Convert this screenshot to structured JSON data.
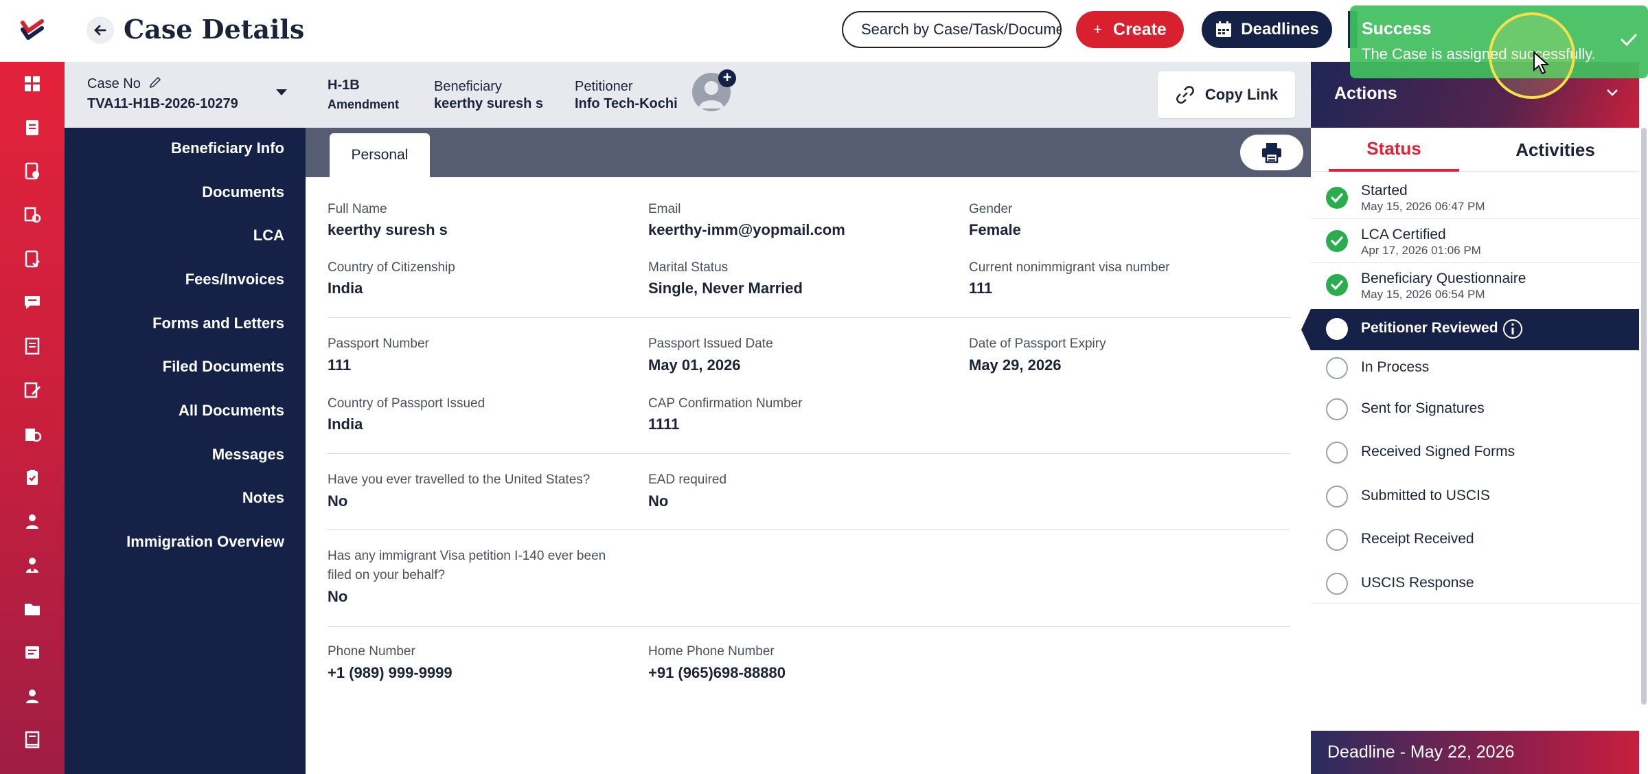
{
  "header": {
    "title": "Case Details",
    "search_placeholder": "Search by Case/Task/Document",
    "create_label": "Create",
    "deadlines_label": "Deadlines"
  },
  "case": {
    "case_no_label": "Case No",
    "case_no": "TVA11-H1B-2026-10279",
    "visa_type": "H-1B",
    "visa_subtype": "Amendment",
    "beneficiary_label": "Beneficiary",
    "beneficiary_name": "keerthy suresh s",
    "petitioner_label": "Petitioner",
    "petitioner_name": "Info Tech-Kochi",
    "copy_link_label": "Copy Link"
  },
  "sidenav": {
    "items": [
      {
        "label": "Beneficiary Info"
      },
      {
        "label": "Documents"
      },
      {
        "label": "LCA"
      },
      {
        "label": "Fees/Invoices"
      },
      {
        "label": "Forms and Letters"
      },
      {
        "label": "Filed Documents"
      },
      {
        "label": "All Documents"
      },
      {
        "label": "Messages"
      },
      {
        "label": "Notes"
      },
      {
        "label": "Immigration Overview"
      }
    ]
  },
  "tabs": {
    "personal": "Personal"
  },
  "fields": {
    "full_name": {
      "label": "Full Name",
      "value": "keerthy suresh s"
    },
    "email": {
      "label": "Email",
      "value": "keerthy-imm@yopmail.com"
    },
    "gender": {
      "label": "Gender",
      "value": "Female"
    },
    "citizenship": {
      "label": "Country of Citizenship",
      "value": "India"
    },
    "marital": {
      "label": "Marital Status",
      "value": "Single, Never Married"
    },
    "visa_number": {
      "label": "Current nonimmigrant visa number",
      "value": "111"
    },
    "passport_number": {
      "label": "Passport Number",
      "value": "111"
    },
    "passport_issued": {
      "label": "Passport Issued Date",
      "value": "May 01, 2026"
    },
    "passport_expiry": {
      "label": "Date of Passport Expiry",
      "value": "May 29, 2026"
    },
    "passport_country": {
      "label": "Country of Passport Issued",
      "value": "India"
    },
    "cap_number": {
      "label": "CAP Confirmation Number",
      "value": "1111"
    },
    "travelled_us": {
      "label": "Have you ever travelled to the United States?",
      "value": "No"
    },
    "ead_required": {
      "label": "EAD required",
      "value": "No"
    },
    "i140_line1": "Has any immigrant Visa petition I-140 ever been",
    "i140_line2": "filed on your behalf?",
    "i140_value": "No",
    "phone": {
      "label": "Phone Number",
      "value": "+1  (989) 999-9999"
    },
    "home_phone": {
      "label": "Home Phone Number",
      "value": "+91  (965)698-88880"
    }
  },
  "actions": {
    "title": "Actions",
    "tab_status": "Status",
    "tab_activities": "Activities",
    "steps": [
      {
        "title": "Started",
        "date": "May 15, 2026 06:47 PM",
        "state": "done"
      },
      {
        "title": "LCA Certified",
        "date": "Apr 17, 2026 01:06 PM",
        "state": "done"
      },
      {
        "title": "Beneficiary Questionnaire",
        "date": "May 15, 2026 06:54 PM",
        "state": "done"
      },
      {
        "title": "Petitioner Reviewed",
        "date": "",
        "state": "active"
      },
      {
        "title": "In Process",
        "date": "",
        "state": "pending"
      },
      {
        "title": "Sent for Signatures",
        "date": "",
        "state": "pending"
      },
      {
        "title": "Received Signed Forms",
        "date": "",
        "state": "pending"
      },
      {
        "title": "Submitted to USCIS",
        "date": "",
        "state": "pending"
      },
      {
        "title": "Receipt Received",
        "date": "",
        "state": "pending"
      },
      {
        "title": "USCIS Response",
        "date": "",
        "state": "pending"
      }
    ],
    "deadline": "Deadline - May 22, 2026"
  },
  "toast": {
    "title": "Success",
    "message": "The Case is assigned successfully."
  },
  "icons": {
    "rail": [
      "dashboard-icon",
      "cases-icon",
      "document-check-icon",
      "forms-icon",
      "task-icon",
      "messages-icon",
      "reports-icon",
      "edit-icon",
      "fees-icon",
      "clipboard-icon",
      "beneficiary-icon",
      "petitioner-icon",
      "folder-icon",
      "notes-icon",
      "user-icon",
      "book-icon"
    ]
  },
  "colors": {
    "brand_red": "#e0233a",
    "navy": "#152147",
    "success_green": "#2bac4e"
  }
}
